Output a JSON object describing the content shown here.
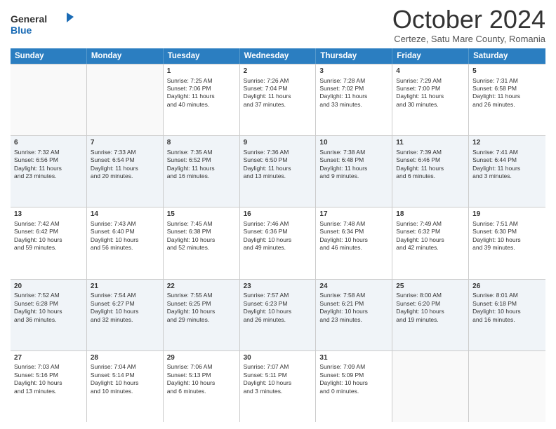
{
  "header": {
    "logo_general": "General",
    "logo_blue": "Blue",
    "month_title": "October 2024",
    "subtitle": "Certeze, Satu Mare County, Romania"
  },
  "days_of_week": [
    "Sunday",
    "Monday",
    "Tuesday",
    "Wednesday",
    "Thursday",
    "Friday",
    "Saturday"
  ],
  "rows": [
    [
      {
        "day": "",
        "lines": [],
        "empty": true
      },
      {
        "day": "",
        "lines": [],
        "empty": true
      },
      {
        "day": "1",
        "lines": [
          "Sunrise: 7:25 AM",
          "Sunset: 7:06 PM",
          "Daylight: 11 hours",
          "and 40 minutes."
        ],
        "empty": false
      },
      {
        "day": "2",
        "lines": [
          "Sunrise: 7:26 AM",
          "Sunset: 7:04 PM",
          "Daylight: 11 hours",
          "and 37 minutes."
        ],
        "empty": false
      },
      {
        "day": "3",
        "lines": [
          "Sunrise: 7:28 AM",
          "Sunset: 7:02 PM",
          "Daylight: 11 hours",
          "and 33 minutes."
        ],
        "empty": false
      },
      {
        "day": "4",
        "lines": [
          "Sunrise: 7:29 AM",
          "Sunset: 7:00 PM",
          "Daylight: 11 hours",
          "and 30 minutes."
        ],
        "empty": false
      },
      {
        "day": "5",
        "lines": [
          "Sunrise: 7:31 AM",
          "Sunset: 6:58 PM",
          "Daylight: 11 hours",
          "and 26 minutes."
        ],
        "empty": false
      }
    ],
    [
      {
        "day": "6",
        "lines": [
          "Sunrise: 7:32 AM",
          "Sunset: 6:56 PM",
          "Daylight: 11 hours",
          "and 23 minutes."
        ],
        "empty": false
      },
      {
        "day": "7",
        "lines": [
          "Sunrise: 7:33 AM",
          "Sunset: 6:54 PM",
          "Daylight: 11 hours",
          "and 20 minutes."
        ],
        "empty": false
      },
      {
        "day": "8",
        "lines": [
          "Sunrise: 7:35 AM",
          "Sunset: 6:52 PM",
          "Daylight: 11 hours",
          "and 16 minutes."
        ],
        "empty": false
      },
      {
        "day": "9",
        "lines": [
          "Sunrise: 7:36 AM",
          "Sunset: 6:50 PM",
          "Daylight: 11 hours",
          "and 13 minutes."
        ],
        "empty": false
      },
      {
        "day": "10",
        "lines": [
          "Sunrise: 7:38 AM",
          "Sunset: 6:48 PM",
          "Daylight: 11 hours",
          "and 9 minutes."
        ],
        "empty": false
      },
      {
        "day": "11",
        "lines": [
          "Sunrise: 7:39 AM",
          "Sunset: 6:46 PM",
          "Daylight: 11 hours",
          "and 6 minutes."
        ],
        "empty": false
      },
      {
        "day": "12",
        "lines": [
          "Sunrise: 7:41 AM",
          "Sunset: 6:44 PM",
          "Daylight: 11 hours",
          "and 3 minutes."
        ],
        "empty": false
      }
    ],
    [
      {
        "day": "13",
        "lines": [
          "Sunrise: 7:42 AM",
          "Sunset: 6:42 PM",
          "Daylight: 10 hours",
          "and 59 minutes."
        ],
        "empty": false
      },
      {
        "day": "14",
        "lines": [
          "Sunrise: 7:43 AM",
          "Sunset: 6:40 PM",
          "Daylight: 10 hours",
          "and 56 minutes."
        ],
        "empty": false
      },
      {
        "day": "15",
        "lines": [
          "Sunrise: 7:45 AM",
          "Sunset: 6:38 PM",
          "Daylight: 10 hours",
          "and 52 minutes."
        ],
        "empty": false
      },
      {
        "day": "16",
        "lines": [
          "Sunrise: 7:46 AM",
          "Sunset: 6:36 PM",
          "Daylight: 10 hours",
          "and 49 minutes."
        ],
        "empty": false
      },
      {
        "day": "17",
        "lines": [
          "Sunrise: 7:48 AM",
          "Sunset: 6:34 PM",
          "Daylight: 10 hours",
          "and 46 minutes."
        ],
        "empty": false
      },
      {
        "day": "18",
        "lines": [
          "Sunrise: 7:49 AM",
          "Sunset: 6:32 PM",
          "Daylight: 10 hours",
          "and 42 minutes."
        ],
        "empty": false
      },
      {
        "day": "19",
        "lines": [
          "Sunrise: 7:51 AM",
          "Sunset: 6:30 PM",
          "Daylight: 10 hours",
          "and 39 minutes."
        ],
        "empty": false
      }
    ],
    [
      {
        "day": "20",
        "lines": [
          "Sunrise: 7:52 AM",
          "Sunset: 6:28 PM",
          "Daylight: 10 hours",
          "and 36 minutes."
        ],
        "empty": false
      },
      {
        "day": "21",
        "lines": [
          "Sunrise: 7:54 AM",
          "Sunset: 6:27 PM",
          "Daylight: 10 hours",
          "and 32 minutes."
        ],
        "empty": false
      },
      {
        "day": "22",
        "lines": [
          "Sunrise: 7:55 AM",
          "Sunset: 6:25 PM",
          "Daylight: 10 hours",
          "and 29 minutes."
        ],
        "empty": false
      },
      {
        "day": "23",
        "lines": [
          "Sunrise: 7:57 AM",
          "Sunset: 6:23 PM",
          "Daylight: 10 hours",
          "and 26 minutes."
        ],
        "empty": false
      },
      {
        "day": "24",
        "lines": [
          "Sunrise: 7:58 AM",
          "Sunset: 6:21 PM",
          "Daylight: 10 hours",
          "and 23 minutes."
        ],
        "empty": false
      },
      {
        "day": "25",
        "lines": [
          "Sunrise: 8:00 AM",
          "Sunset: 6:20 PM",
          "Daylight: 10 hours",
          "and 19 minutes."
        ],
        "empty": false
      },
      {
        "day": "26",
        "lines": [
          "Sunrise: 8:01 AM",
          "Sunset: 6:18 PM",
          "Daylight: 10 hours",
          "and 16 minutes."
        ],
        "empty": false
      }
    ],
    [
      {
        "day": "27",
        "lines": [
          "Sunrise: 7:03 AM",
          "Sunset: 5:16 PM",
          "Daylight: 10 hours",
          "and 13 minutes."
        ],
        "empty": false
      },
      {
        "day": "28",
        "lines": [
          "Sunrise: 7:04 AM",
          "Sunset: 5:14 PM",
          "Daylight: 10 hours",
          "and 10 minutes."
        ],
        "empty": false
      },
      {
        "day": "29",
        "lines": [
          "Sunrise: 7:06 AM",
          "Sunset: 5:13 PM",
          "Daylight: 10 hours",
          "and 6 minutes."
        ],
        "empty": false
      },
      {
        "day": "30",
        "lines": [
          "Sunrise: 7:07 AM",
          "Sunset: 5:11 PM",
          "Daylight: 10 hours",
          "and 3 minutes."
        ],
        "empty": false
      },
      {
        "day": "31",
        "lines": [
          "Sunrise: 7:09 AM",
          "Sunset: 5:09 PM",
          "Daylight: 10 hours",
          "and 0 minutes."
        ],
        "empty": false
      },
      {
        "day": "",
        "lines": [],
        "empty": true
      },
      {
        "day": "",
        "lines": [],
        "empty": true
      }
    ]
  ]
}
